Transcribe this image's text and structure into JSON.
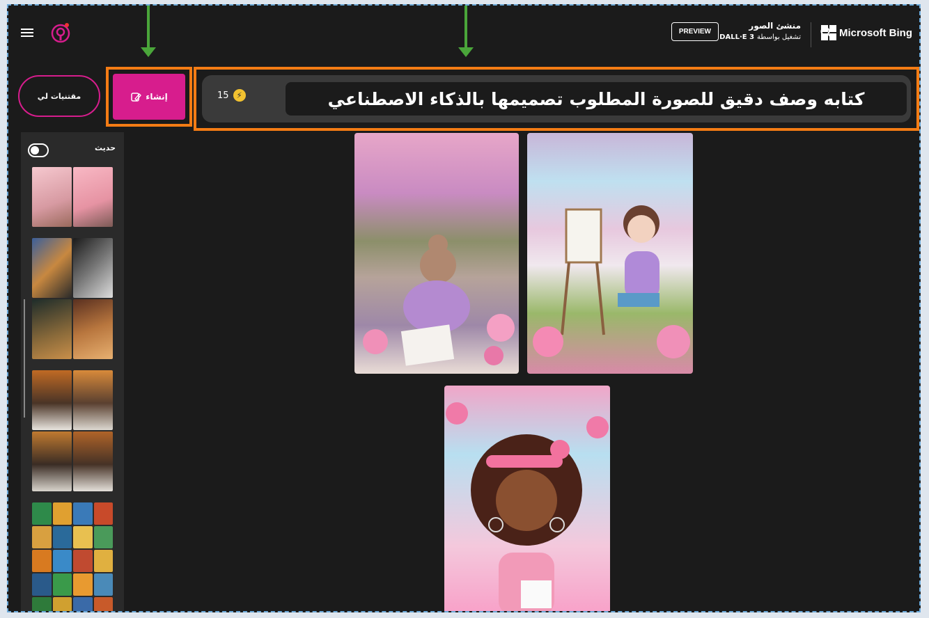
{
  "header": {
    "brand": "Microsoft Bing",
    "app_title": "منشئ الصور",
    "powered_by": "تشغيل بواسطة",
    "model": "DALL·E 3",
    "preview_label": "PREVIEW"
  },
  "prompt": {
    "text": "كتابه وصف دقيق للصورة المطلوب تصميمها بالذكاء الاصطناعي",
    "boost_count": "15"
  },
  "actions": {
    "create_label": "إنشاء",
    "my_creations_label": "مقتنيات لي"
  },
  "sidebar": {
    "recent_label": "حديث"
  },
  "colors": {
    "accent_pink": "#d71d8d",
    "highlight_orange": "#f47c14",
    "arrow_green": "#4aa63a",
    "background": "#1b1b1b"
  }
}
